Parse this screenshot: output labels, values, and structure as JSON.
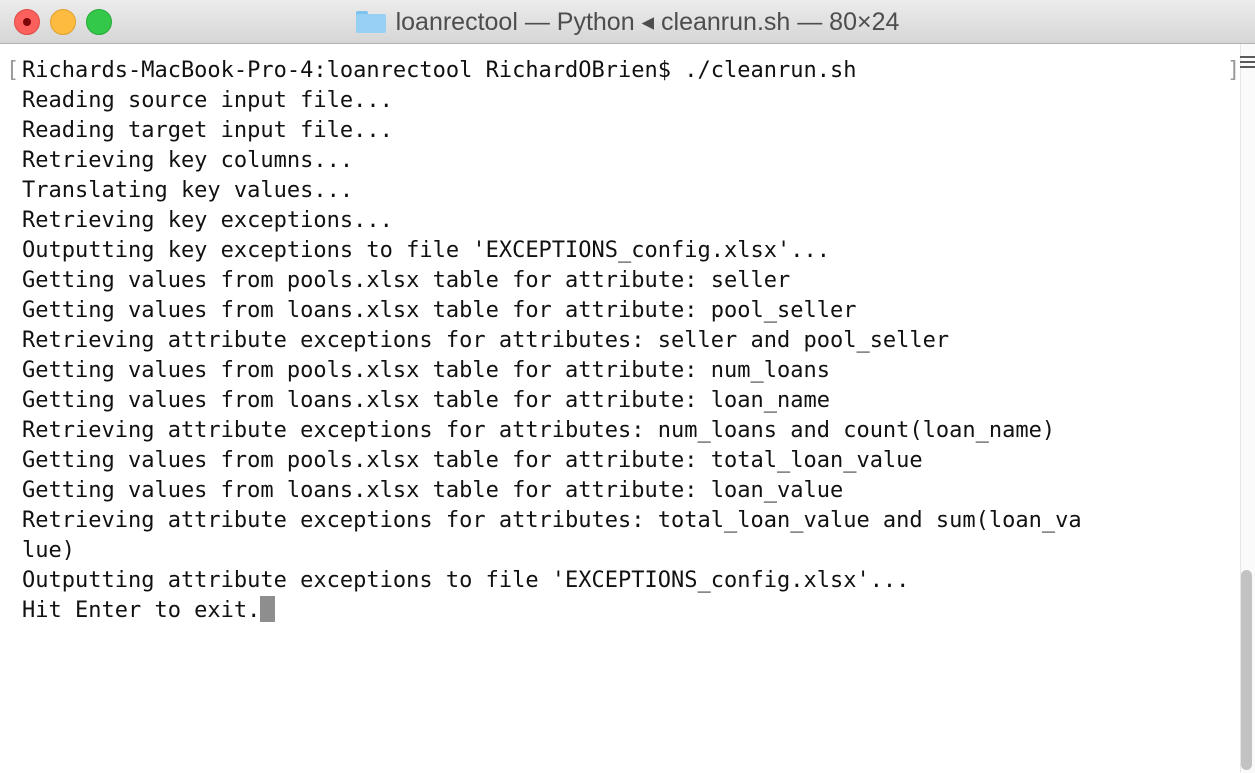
{
  "window": {
    "title": "loanrectool — Python ◂ cleanrun.sh — 80×24"
  },
  "terminal": {
    "lines": [
      "Richards-MacBook-Pro-4:loanrectool RichardOBrien$ ./cleanrun.sh",
      "Reading source input file...",
      "Reading target input file...",
      "Retrieving key columns...",
      "Translating key values...",
      "Retrieving key exceptions...",
      "Outputting key exceptions to file 'EXCEPTIONS_config.xlsx'...",
      "Getting values from pools.xlsx table for attribute: seller",
      "Getting values from loans.xlsx table for attribute: pool_seller",
      "Retrieving attribute exceptions for attributes: seller and pool_seller",
      "Getting values from pools.xlsx table for attribute: num_loans",
      "Getting values from loans.xlsx table for attribute: loan_name",
      "Retrieving attribute exceptions for attributes: num_loans and count(loan_name)",
      "Getting values from pools.xlsx table for attribute: total_loan_value",
      "Getting values from loans.xlsx table for attribute: loan_value",
      "Retrieving attribute exceptions for attributes: total_loan_value and sum(loan_va",
      "lue)",
      "Outputting attribute exceptions to file 'EXCEPTIONS_config.xlsx'...",
      "Hit Enter to exit."
    ],
    "bracket_open": "[",
    "bracket_close": "]"
  },
  "icons": {
    "close": "close-button-icon",
    "minimize": "minimize-button-icon",
    "maximize": "maximize-button-icon",
    "folder": "folder-icon",
    "split": "split-pane-icon",
    "cursor": "block-cursor"
  },
  "colors": {
    "close": "#fc605c",
    "minimize": "#fdbc40",
    "maximize": "#34c84a",
    "folder": "#96d0f4",
    "text": "#111111",
    "cursor": "#8e8e8e"
  }
}
